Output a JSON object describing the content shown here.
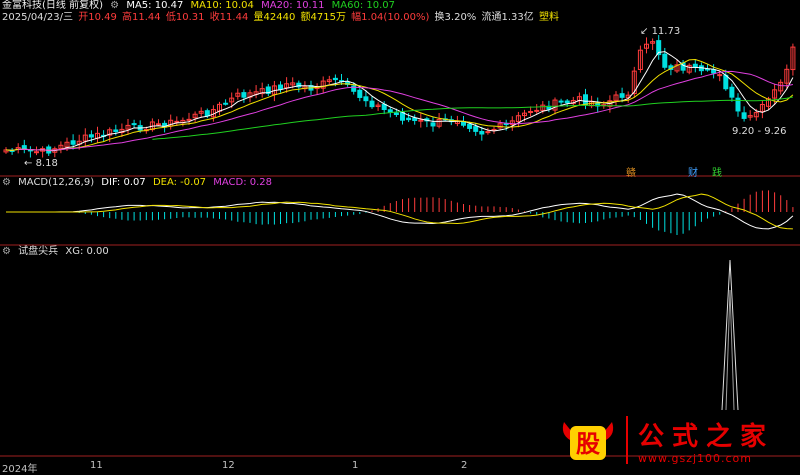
{
  "header": {
    "stock": "金富科技(日线 前复权)",
    "ma5": "MA5: 10.47",
    "ma10": "MA10: 10.04",
    "ma20": "MA20: 10.11",
    "ma60": "MA60: 10.07",
    "date": "2025/04/23/三",
    "open": "开10.49",
    "high": "高11.44",
    "low": "低10.31",
    "close": "收11.44",
    "vol": "量42440",
    "amount": "额4715万",
    "chg": "幅1.04(10.00%)",
    "turnover": "换3.20%",
    "float": "流通1.33亿",
    "industry": "塑料"
  },
  "annotations": {
    "high_label": "11.73",
    "low_label": "8.18",
    "range_label": "9.20 - 9.26",
    "mark1": "赣",
    "mark2": "财",
    "mark3": "践"
  },
  "macd": {
    "title": "MACD(12,26,9)",
    "dif": "DIF: 0.07",
    "dea": "DEA: -0.07",
    "macd": "MACD: 0.28"
  },
  "indicator": {
    "title": "试盘尖兵",
    "xg": "XG: 0.00"
  },
  "xaxis": {
    "labels": [
      "2024年",
      "11",
      "12",
      "1",
      "2"
    ]
  },
  "watermark": {
    "logo": "股",
    "title": "公式之家",
    "url": "www.gszj100.com"
  },
  "colors": {
    "up": "#ff3c3c",
    "down": "#00e0e0",
    "ma5": "#ffffff",
    "ma10": "#f0e000",
    "ma20": "#e040e0",
    "ma60": "#20d020"
  }
}
